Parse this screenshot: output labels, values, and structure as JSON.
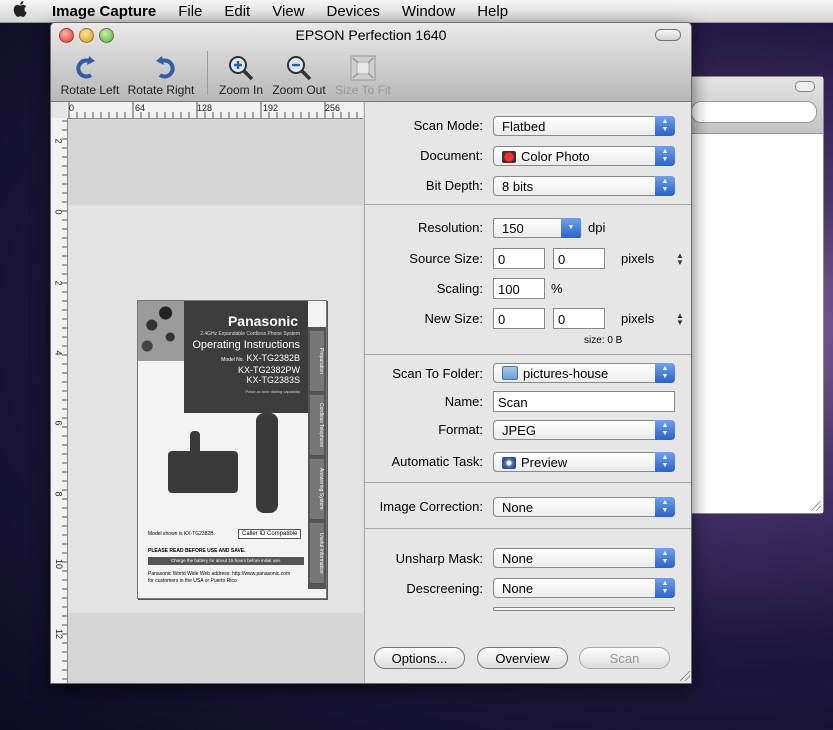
{
  "menubar": {
    "app_name": "Image Capture",
    "items": [
      "File",
      "Edit",
      "View",
      "Devices",
      "Window",
      "Help"
    ]
  },
  "window": {
    "title": "EPSON Perfection 1640"
  },
  "toolbar": {
    "rotate_left": "Rotate Left",
    "rotate_right": "Rotate Right",
    "zoom_in": "Zoom In",
    "zoom_out": "Zoom Out",
    "size_to_fit": "Size To Fit"
  },
  "ruler": {
    "h_labels": [
      "0",
      "64",
      "128",
      "192",
      "256"
    ],
    "v_labels": [
      "2",
      "0",
      "2",
      "4",
      "6",
      "8",
      "10",
      "12"
    ]
  },
  "booklet": {
    "brand": "Panasonic",
    "subtitle": "2.4GHz Expandable Cordless Phone System",
    "heading": "Operating Instructions",
    "model_prefix": "Model No.",
    "models": [
      "KX-TG2382B",
      "KX-TG2382PW",
      "KX-TG2383S"
    ],
    "pulse": "Pulse-or-tone dialing capability",
    "tabs": [
      "Preparation",
      "Cordless Telephone",
      "Answering System",
      "Useful Information"
    ],
    "model_shown": "Model shown is KX-TG2382B.",
    "caller_id": "Caller ID Compatible",
    "warning": "PLEASE READ BEFORE USE AND SAVE.",
    "charge": "Charge the battery for about 15 hours before initial use.",
    "web": "Panasonic World Wide Web address: http://www.panasonic.com",
    "customers": "for customers in the USA or Puerto Rico"
  },
  "settings": {
    "scan_mode": {
      "label": "Scan Mode:",
      "value": "Flatbed"
    },
    "document": {
      "label": "Document:",
      "value": "Color Photo"
    },
    "bit_depth": {
      "label": "Bit Depth:",
      "value": "8 bits"
    },
    "resolution": {
      "label": "Resolution:",
      "value": "150",
      "unit": "dpi"
    },
    "source_size": {
      "label": "Source Size:",
      "w": "0",
      "h": "0",
      "unit": "pixels"
    },
    "scaling": {
      "label": "Scaling:",
      "value": "100",
      "unit": "%"
    },
    "new_size": {
      "label": "New Size:",
      "w": "0",
      "h": "0",
      "unit": "pixels"
    },
    "size_readout": "size:  0 B",
    "scan_to_folder": {
      "label": "Scan To Folder:",
      "value": "pictures-house"
    },
    "name": {
      "label": "Name:",
      "value": "Scan"
    },
    "format": {
      "label": "Format:",
      "value": "JPEG"
    },
    "automatic_task": {
      "label": "Automatic Task:",
      "value": "Preview"
    },
    "image_correction": {
      "label": "Image Correction:",
      "value": "None"
    },
    "unsharp_mask": {
      "label": "Unsharp Mask:",
      "value": "None"
    },
    "descreening": {
      "label": "Descreening:",
      "value": "None"
    }
  },
  "buttons": {
    "options": "Options...",
    "overview": "Overview",
    "scan": "Scan"
  },
  "colors": {
    "popup_accent": "#2a62c9",
    "folder_icon": "#7fa8d8"
  }
}
